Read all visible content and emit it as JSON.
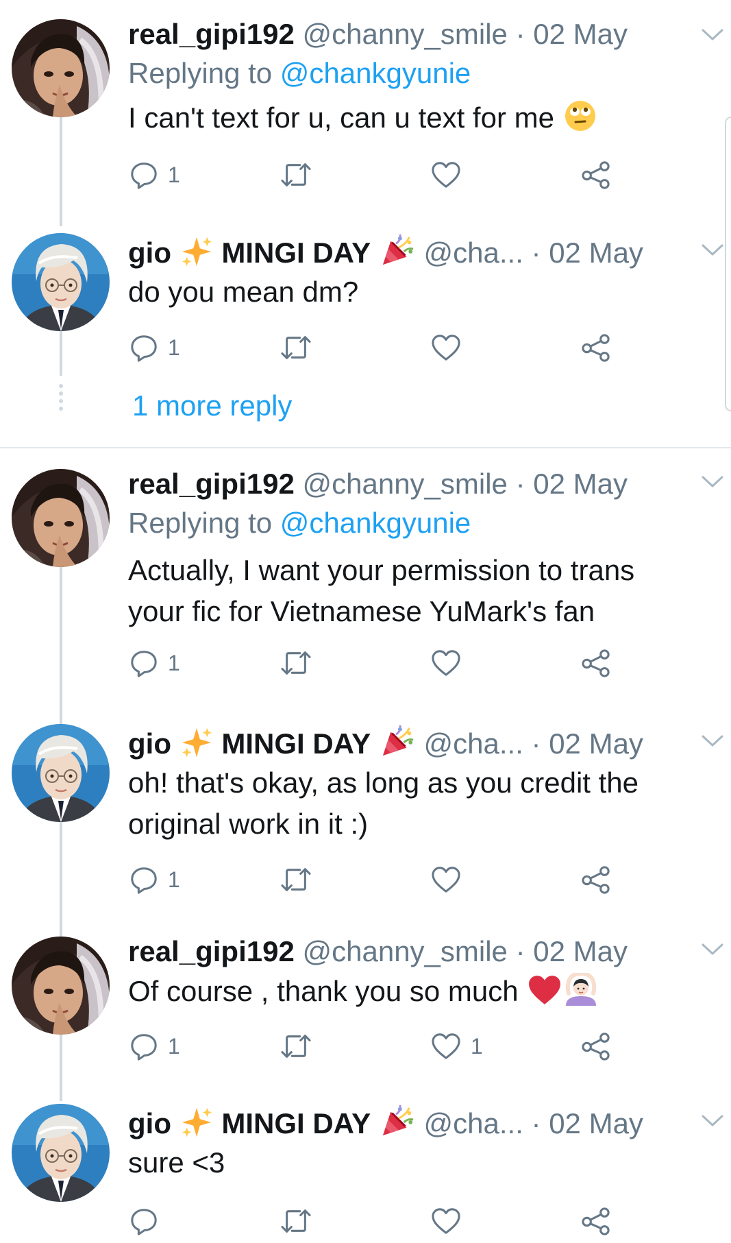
{
  "colors": {
    "text": "#14171a",
    "muted": "#657786",
    "link": "#1da1f2",
    "thread_line": "#cfd9de",
    "heart_red": "#e0245e"
  },
  "tweets": [
    {
      "display_name": "real_gipi192",
      "handle": "@channy_smile",
      "separator": "·",
      "date": "02 May",
      "replying_prefix": "Replying to",
      "replying_to": "@chankgyunie",
      "text": "I can't text for u, can u text for me",
      "text_emoji": "face-with-rolling-eyes",
      "reply_count": "1",
      "like_count": ""
    },
    {
      "display_name_part1": "gio",
      "display_name_emoji1": "sparkles",
      "display_name_part2": "MINGI DAY",
      "display_name_emoji2": "party-popper",
      "handle": "@cha...",
      "separator": "·",
      "date": "02 May",
      "text": "do you mean dm?",
      "reply_count": "1",
      "like_count": ""
    },
    {
      "display_name": "real_gipi192",
      "handle": "@channy_smile",
      "separator": "·",
      "date": "02 May",
      "replying_prefix": "Replying to",
      "replying_to": "@chankgyunie",
      "text_line1": "Actually,  I want your permission to trans",
      "text_line2": "your fic for Vietnamese YuMark's fan",
      "reply_count": "1",
      "like_count": ""
    },
    {
      "display_name_part1": "gio",
      "display_name_emoji1": "sparkles",
      "display_name_part2": "MINGI DAY",
      "display_name_emoji2": "party-popper",
      "handle": "@cha...",
      "separator": "·",
      "date": "02 May",
      "text_line1": "oh! that's okay, as long as you credit the",
      "text_line2": "original work in it :)",
      "reply_count": "1",
      "like_count": ""
    },
    {
      "display_name": "real_gipi192",
      "handle": "@channy_smile",
      "separator": "·",
      "date": "02 May",
      "text": "Of course , thank you so much",
      "text_emojis": [
        "red-heart",
        "person-gesturing-ok"
      ],
      "reply_count": "1",
      "like_count": "1"
    },
    {
      "display_name_part1": "gio",
      "display_name_emoji1": "sparkles",
      "display_name_part2": "MINGI DAY",
      "display_name_emoji2": "party-popper",
      "handle": "@cha...",
      "separator": "·",
      "date": "02 May",
      "text": "sure <3",
      "reply_count": "",
      "like_count": ""
    }
  ],
  "more_replies": "1 more reply",
  "icons": {
    "reply": "reply-icon",
    "retweet": "retweet-icon",
    "like": "heart-icon",
    "share": "share-icon",
    "menu": "chevron-down-icon"
  }
}
